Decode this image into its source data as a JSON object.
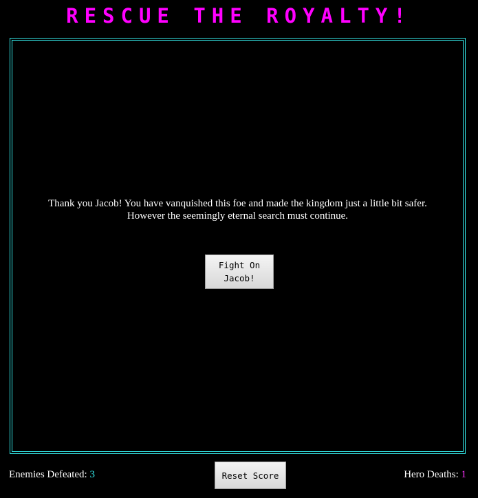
{
  "header": {
    "title": "RESCUE THE ROYALTY!"
  },
  "game": {
    "message_line1": "Thank you Jacob! You have vanquished this foe and made the kingdom just a little bit safer.",
    "message_line2": "However the seemingly eternal search must continue.",
    "fight_button_line1": "Fight On",
    "fight_button_line2": "Jacob!"
  },
  "footer": {
    "enemies_label": "Enemies Defeated:",
    "enemies_count": "3",
    "reset_label": "Reset Score",
    "deaths_label": "Hero Deaths:",
    "deaths_count": "1"
  },
  "colors": {
    "title": "#ff00ff",
    "frame_border": "#33e6e6",
    "enemies_count": "#33e6e6",
    "deaths_count": "#ff33ff",
    "background": "#000000"
  }
}
